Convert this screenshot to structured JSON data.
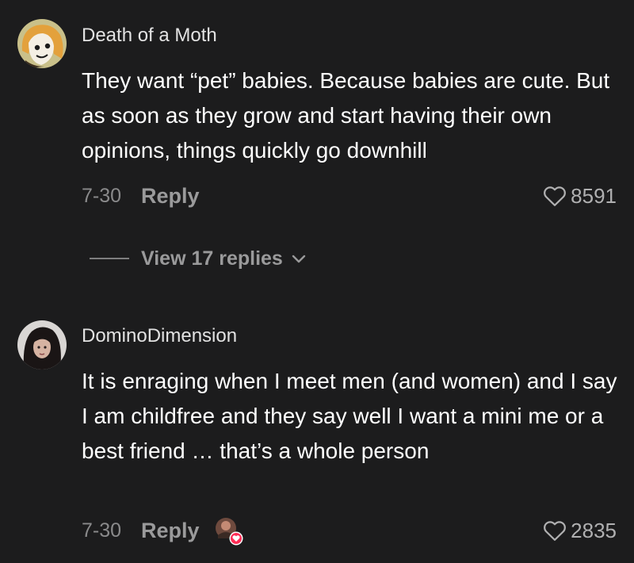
{
  "comments": [
    {
      "username": "Death of a Moth",
      "text": "They want “pet” babies. Because babies are cute. But as soon as they grow and start having their own opinions, things quickly go downhill",
      "date": "7-30",
      "reply_label": "Reply",
      "likes": "8591"
    },
    {
      "username": "DominoDimension",
      "text": "It is enraging when I meet men (and women) and I say I am childfree and they say well I want a mini me or a best friend … that’s a whole person",
      "date": "7-30",
      "reply_label": "Reply",
      "likes": "2835"
    }
  ],
  "view_replies": {
    "label": "View 17 replies"
  },
  "icons": {
    "heart": "heart-outline-icon",
    "chevron": "chevron-down-icon",
    "creator_like_badge": "heart-badge-icon"
  },
  "colors": {
    "background": "#1c1c1d",
    "creator_like_badge": "#fe2c55"
  }
}
